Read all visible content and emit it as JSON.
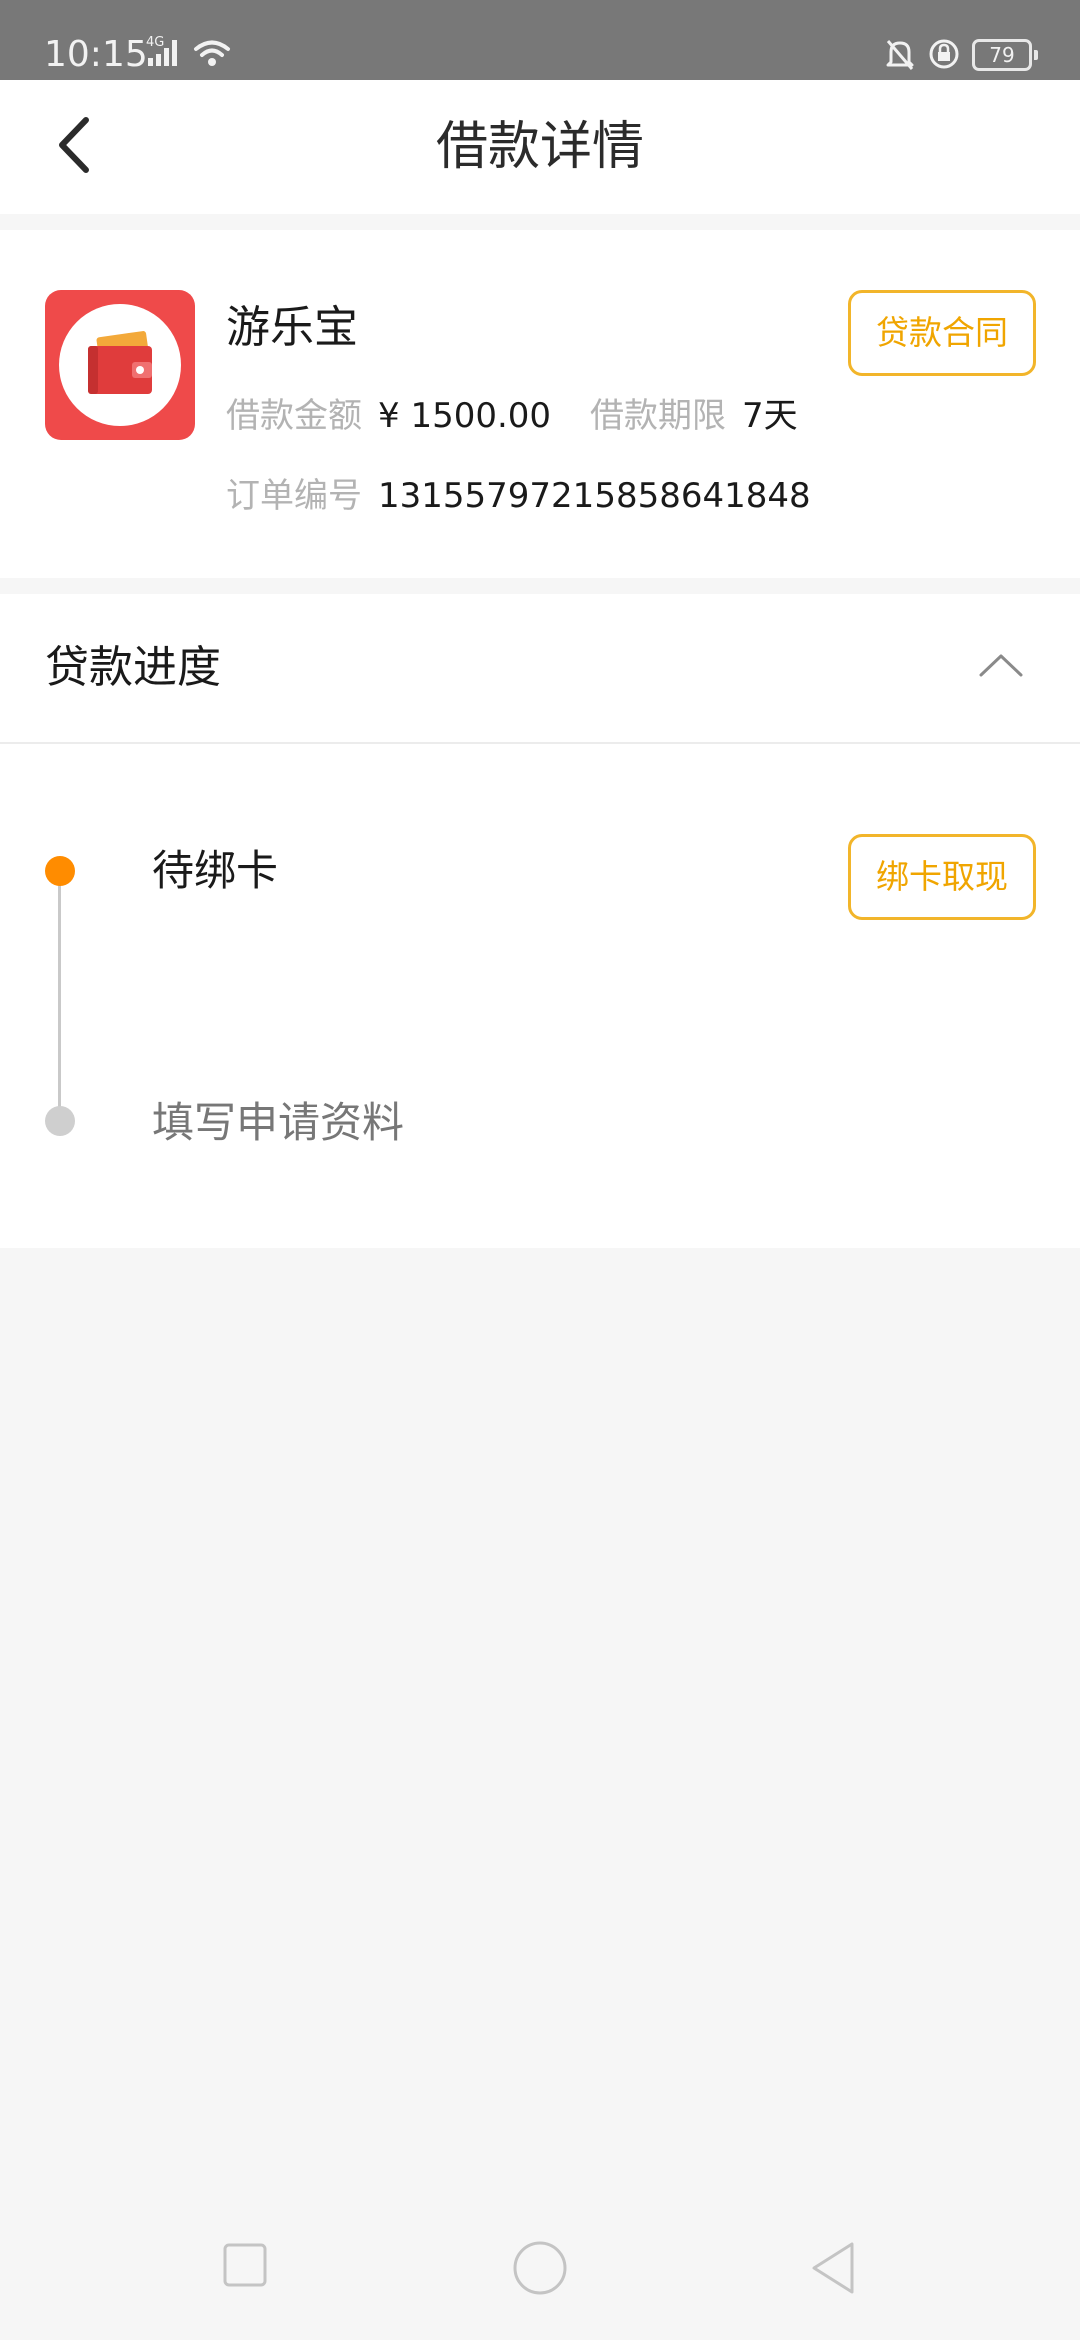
{
  "status_bar": {
    "time": "10:15",
    "network": "4G",
    "battery": "79"
  },
  "header": {
    "title": "借款详情"
  },
  "loan": {
    "app_name": "游乐宝",
    "amount_label": "借款金额",
    "amount_value": "¥ 1500.00",
    "term_label": "借款期限",
    "term_value": "7天",
    "order_label": "订单编号",
    "order_value": "1315579721585864184‌8",
    "contract_button": "贷款合同"
  },
  "progress": {
    "title": "贷款进度",
    "steps": [
      {
        "label": "待绑卡",
        "state": "current",
        "action": "绑卡取现"
      },
      {
        "label": "填写申请资料",
        "state": "done"
      }
    ]
  },
  "colors": {
    "accent": "#f2b52a",
    "active_dot": "#ff8c00",
    "logo_red": "#ef4a4a"
  }
}
